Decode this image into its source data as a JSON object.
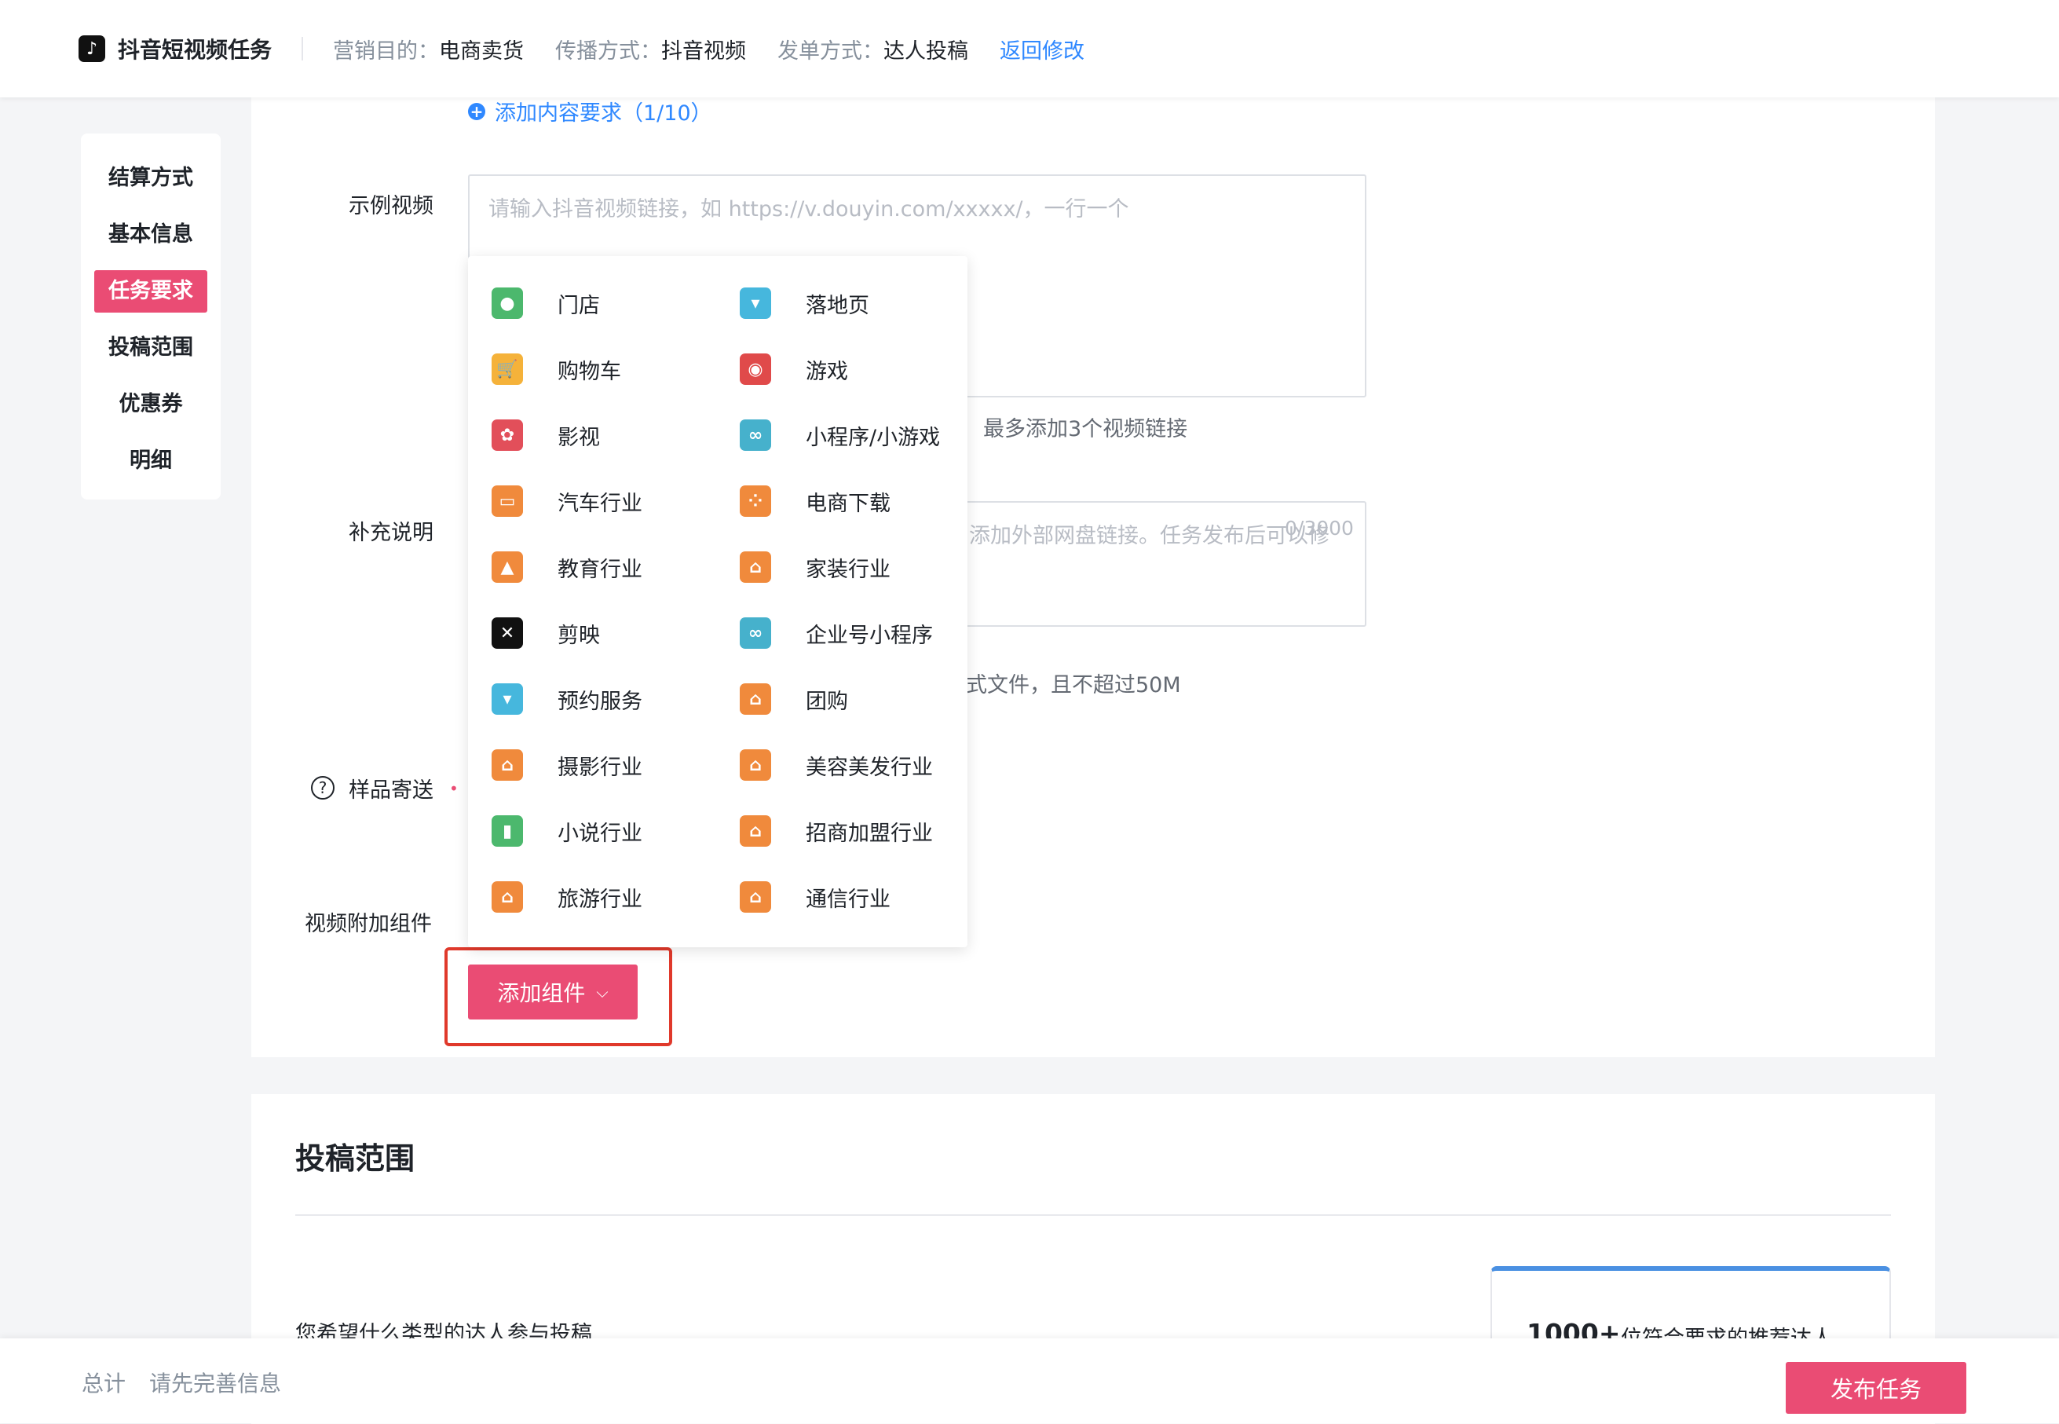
{
  "header": {
    "title": "抖音短视频任务",
    "purpose_label": "营销目的：",
    "purpose_value": "电商卖货",
    "spread_label": "传播方式：",
    "spread_value": "抖音视频",
    "order_label": "发单方式：",
    "order_value": "达人投稿",
    "back_link": "返回修改"
  },
  "nav": {
    "items": [
      "结算方式",
      "基本信息",
      "任务要求",
      "投稿范围",
      "优惠券",
      "明细"
    ],
    "active": "任务要求"
  },
  "form": {
    "add_requirement": "添加内容要求（1/10）",
    "sample_video_label": "示例视频",
    "sample_video_placeholder": "请输入抖音视频链接，如 https://v.douyin.com/xxxxx/，一行一个",
    "sample_video_hint": "最多添加3个视频链接",
    "supplement_label": "补充说明",
    "supplement_placeholder": "添加外部网盘链接。任务发布后可以修",
    "supplement_counter": "0/3000",
    "upload_hint": "式文件，且不超过50M",
    "sample_ship_label": "样品寄送",
    "attach_label": "视频附加组件",
    "add_component_button": "添加组件"
  },
  "dropdown": {
    "items": [
      {
        "label": "门店",
        "icon": "location-icon",
        "color": "#4cb86d"
      },
      {
        "label": "落地页",
        "icon": "chat-bubble-icon",
        "color": "#46b7dd"
      },
      {
        "label": "购物车",
        "icon": "cart-icon",
        "color": "#f5b23a"
      },
      {
        "label": "游戏",
        "icon": "game-icon",
        "color": "#e04a4a"
      },
      {
        "label": "影视",
        "icon": "film-icon",
        "color": "#e24f5a"
      },
      {
        "label": "小程序/小游戏",
        "icon": "mini-program-icon",
        "color": "#46b1cc"
      },
      {
        "label": "汽车行业",
        "icon": "car-icon",
        "color": "#f08a3c"
      },
      {
        "label": "电商下载",
        "icon": "apps-icon",
        "color": "#f08a3c"
      },
      {
        "label": "教育行业",
        "icon": "graduation-cap-icon",
        "color": "#f08a3c"
      },
      {
        "label": "家装行业",
        "icon": "house-icon",
        "color": "#f08a3c"
      },
      {
        "label": "剪映",
        "icon": "capcut-icon",
        "color": "#111111"
      },
      {
        "label": "企业号小程序",
        "icon": "mini-program-icon",
        "color": "#46b1cc"
      },
      {
        "label": "预约服务",
        "icon": "chat-bubble-icon",
        "color": "#46b7dd"
      },
      {
        "label": "团购",
        "icon": "house-icon",
        "color": "#f08a3c"
      },
      {
        "label": "摄影行业",
        "icon": "house-icon",
        "color": "#f08a3c"
      },
      {
        "label": "美容美发行业",
        "icon": "house-icon",
        "color": "#f08a3c"
      },
      {
        "label": "小说行业",
        "icon": "book-icon",
        "color": "#4cb86d"
      },
      {
        "label": "招商加盟行业",
        "icon": "house-icon",
        "color": "#f08a3c"
      },
      {
        "label": "旅游行业",
        "icon": "house-icon",
        "color": "#f08a3c"
      },
      {
        "label": "通信行业",
        "icon": "house-icon",
        "color": "#f08a3c"
      }
    ]
  },
  "section2": {
    "title": "投稿范围",
    "question": "您希望什么类型的达人参与投稿",
    "rec_count": "1000+",
    "rec_text": "位符合要求的推荐达人"
  },
  "footer": {
    "total_label": "总计",
    "total_value": "请先完善信息",
    "publish_button": "发布任务"
  },
  "colors": {
    "accent": "#ea4c74",
    "link": "#2f88ff",
    "highlight": "#e0392b"
  }
}
